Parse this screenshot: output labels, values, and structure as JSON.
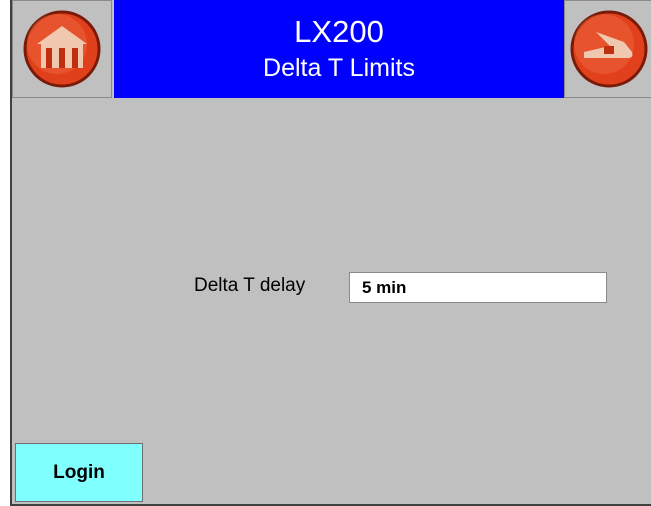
{
  "header": {
    "title": "LX200",
    "subtitle": "Delta T Limits",
    "left_icon": "home-icon",
    "right_icon": "back-icon"
  },
  "form": {
    "delta_t_delay_label": "Delta T delay",
    "delta_t_delay_value": "5 min"
  },
  "footer": {
    "login_label": "Login"
  },
  "colors": {
    "header_bg": "#0000ff",
    "screen_bg": "#c0c0c0",
    "icon_red": "#e0401c",
    "login_bg": "#80ffff"
  }
}
